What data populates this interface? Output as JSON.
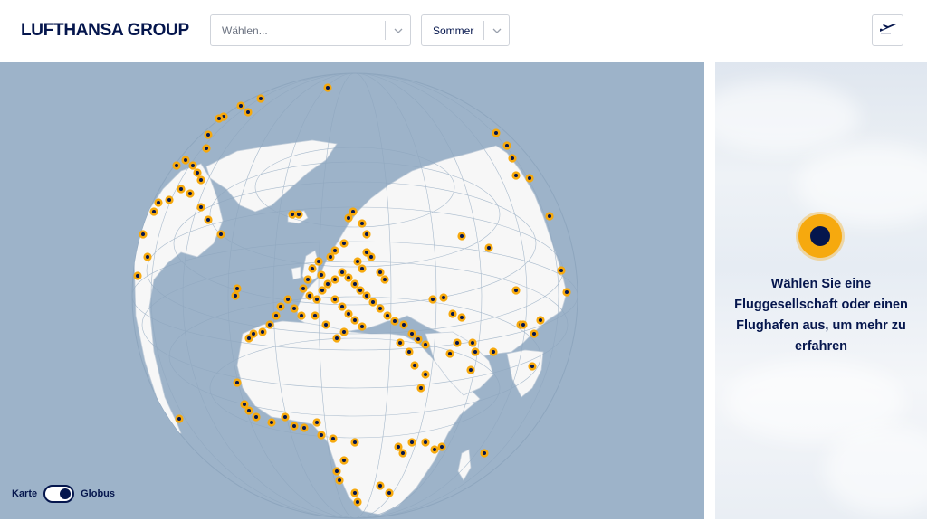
{
  "brand": {
    "logo_text": "LUFTHANSA GROUP"
  },
  "filters": {
    "airline_select": {
      "placeholder": "Wählen..."
    },
    "season_select": {
      "value": "Sommer"
    }
  },
  "map": {
    "view_mode": {
      "left_label": "Karte",
      "right_label": "Globus",
      "active": "Globus"
    },
    "colors": {
      "ocean": "#9db3c9",
      "land": "#f7f7f7",
      "marker_ring": "#f6a90e",
      "marker_center": "#05164d"
    }
  },
  "info_panel": {
    "message": "Wählen Sie eine Fluggesellschaft oder einen Flughafen aus, um mehr zu erfahren"
  },
  "icons": {
    "plane": "plane-icon",
    "chevron": "chevron-down-icon"
  }
}
